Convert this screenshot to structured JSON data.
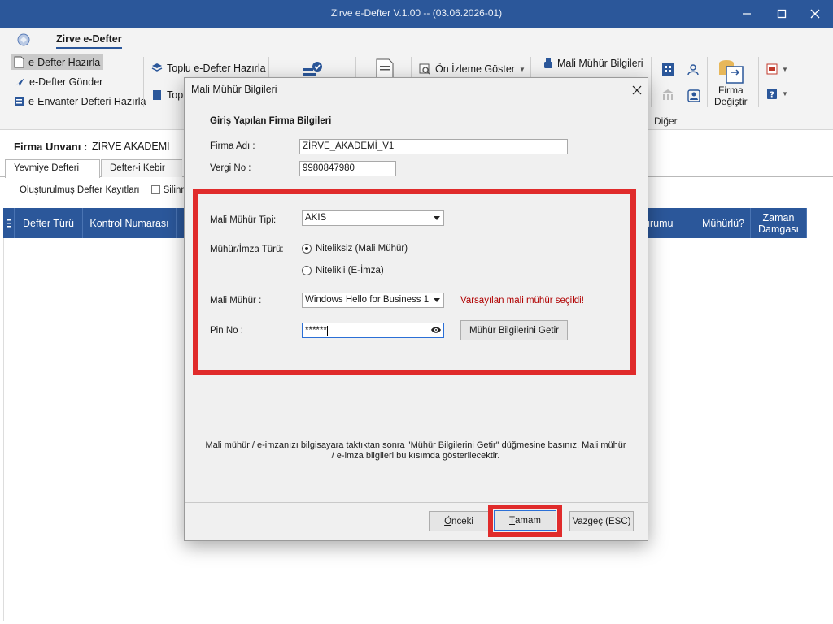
{
  "window": {
    "title": "Zirve e-Defter V.1.00  -- (03.06.2026-01)"
  },
  "ribbon": {
    "tab": "Zirve e-Defter",
    "left_items": [
      "e-Defter Hazırla",
      "e-Defter Gönder",
      "e-Envanter Defteri Hazırla"
    ],
    "toplu_hazirla": "Toplu e-Defter Hazırla",
    "toplu_truncated": "Topl",
    "on_izleme": "Ön İzleme Göster",
    "mali_muhur_bilgileri": "Mali Mühür Bilgileri",
    "firma_degistir_line1": "Firma",
    "firma_degistir_line2": "Değiştir",
    "diger_label": "Diğer"
  },
  "main": {
    "firma_label": "Firma Unvanı :",
    "firma_value": "ZİRVE AKADEMİ",
    "tabs": [
      "Yevmiye Defteri",
      "Defter-i Kebir"
    ],
    "olusturulmus": "Oluşturulmuş Defter Kayıtları",
    "silinmis": "Silinmiş",
    "columns": {
      "defter_turu": "Defter Türü",
      "kontrol_numarasi": "Kontrol Numarası",
      "durumu": "urumu",
      "muhurlu": "Mühürlü?",
      "zaman_line1": "Zaman",
      "zaman_line2": "Damgası"
    }
  },
  "dialog": {
    "title": "Mali Mühür Bilgileri",
    "heading": "Giriş Yapılan Firma Bilgileri",
    "firma_adi_label": "Firma Adı :",
    "firma_adi_value": "ZİRVE_AKADEMİ_V1",
    "vergi_no_label": "Vergi No :",
    "vergi_no_value": "9980847980",
    "muhur_tipi_label": "Mali Mühür Tipi:",
    "muhur_tipi_value": "AKIS",
    "imza_turu_label": "Mühür/İmza Türü:",
    "radio_niteliksiz": "Niteliksiz (Mali Mühür)",
    "radio_nitelikli": "Nitelikli (E-İmza)",
    "mali_muhur_label": "Mali Mühür :",
    "mali_muhur_value": "Windows Hello for Business 1",
    "warning": "Varsayılan mali mühür seçildi!",
    "pin_label": "Pin No :",
    "pin_value": "******",
    "get_button": "Mühür Bilgilerini Getir",
    "info_line1": "Mali mühür / e-imzanızı bilgisayara taktıktan sonra \"Mühür Bilgilerini Getir\" düğmesine basınız. Mali mühür",
    "info_line2": "/ e-imza bilgileri bu kısımda gösterilecektir.",
    "btn_prev_first": "Ö",
    "btn_prev_rest": "nceki",
    "btn_ok_first": "T",
    "btn_ok_rest": "amam",
    "btn_cancel": "Vazgeç (ESC)"
  },
  "colors": {
    "accent": "#2b579a",
    "highlight": "#e02b2b",
    "warning": "#b00000"
  }
}
